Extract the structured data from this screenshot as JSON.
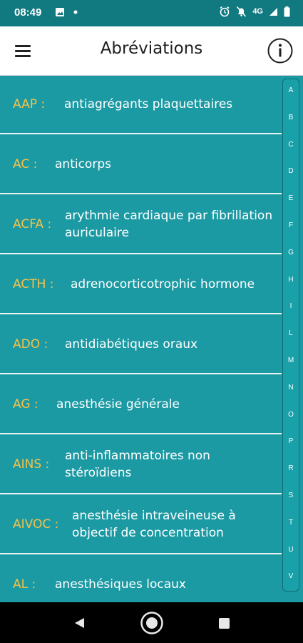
{
  "status": {
    "time": "08:49",
    "network": "4G"
  },
  "app_bar": {
    "title": "Abréviations"
  },
  "colors": {
    "background": "#1c9aa4",
    "status_bar": "#107a80",
    "abbr_text": "#f4c24a",
    "divider": "#e6f4f5"
  },
  "entries": [
    {
      "abbr": "AAP :",
      "def": "antiagrégants plaquettaires"
    },
    {
      "abbr": "AC :",
      "def": "anticorps"
    },
    {
      "abbr": "ACFA :",
      "def": "arythmie cardiaque par fibrillation auriculaire"
    },
    {
      "abbr": "ACTH :",
      "def": "adrenocorticotrophic hormone"
    },
    {
      "abbr": "ADO :",
      "def": "antidiabétiques oraux"
    },
    {
      "abbr": "AG :",
      "def": "anesthésie générale"
    },
    {
      "abbr": "AINS :",
      "def": "anti-inflammatoires non stéroïdiens"
    },
    {
      "abbr": "AIVOC :",
      "def": "anesthésie intraveineuse à objectif de concentration"
    },
    {
      "abbr": "AL :",
      "def": "anesthésiques locaux"
    }
  ],
  "index_letters": [
    "A",
    "B",
    "C",
    "D",
    "E",
    "F",
    "G",
    "H",
    "I",
    "L",
    "M",
    "N",
    "O",
    "P",
    "R",
    "S",
    "T",
    "U",
    "V"
  ],
  "icons": {
    "menu": "hamburger-menu-icon",
    "info": "info-icon",
    "back": "back-triangle-icon",
    "home": "home-circle-icon",
    "recents": "recents-square-icon"
  }
}
